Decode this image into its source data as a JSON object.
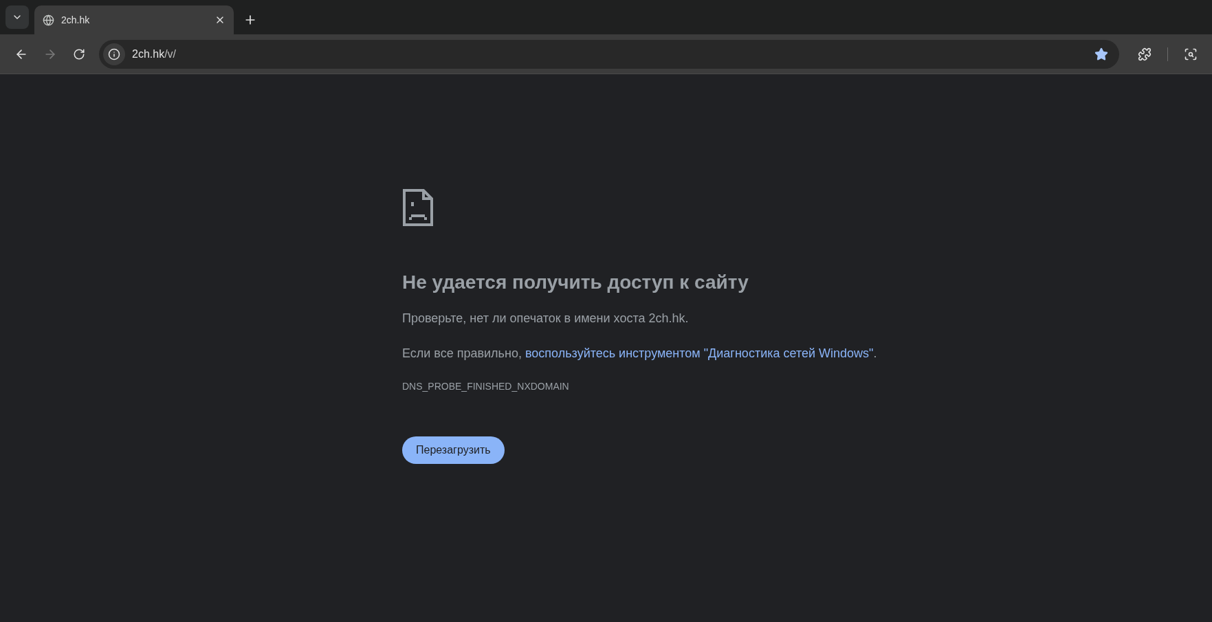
{
  "tabs": [
    {
      "title": "2ch.hk",
      "selected": true
    }
  ],
  "address_bar": {
    "host": "2ch.hk",
    "path": "/v/",
    "bookmarked": true
  },
  "navigation": {
    "back_disabled": false,
    "forward_disabled": true
  },
  "error_page": {
    "title": "Не удается получить доступ к сайту",
    "hint": "Проверьте, нет ли опечаток в имени хоста 2ch.hk.",
    "diagnose_prefix": "Если все правильно, ",
    "diagnose_link": "воспользуйтесь инструментом \"Диагностика сетей Windows\"",
    "diagnose_suffix": ".",
    "error_code": "DNS_PROBE_FINISHED_NXDOMAIN",
    "reload_button": "Перезагрузить"
  }
}
